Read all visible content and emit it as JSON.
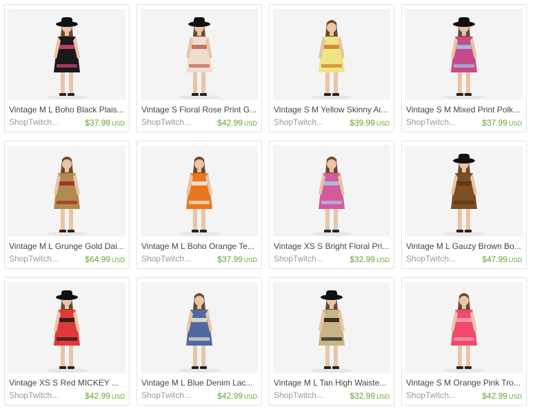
{
  "listings": [
    {
      "title": "Vintage M L Boho Black Plais...",
      "shop": "ShopTwitch...",
      "price": "$37.99",
      "currency": "USD",
      "garment_color": "#1a1a1a",
      "accent_color": "#d9477a",
      "hat": true
    },
    {
      "title": "Vintage S Floral Rose Print G...",
      "shop": "ShopTwitch...",
      "price": "$42.99",
      "currency": "USD",
      "garment_color": "#f0ddd0",
      "accent_color": "#c0614a",
      "hat": true
    },
    {
      "title": "Vintage S M Yellow Skinny Ai...",
      "shop": "ShopTwitch...",
      "price": "$39.99",
      "currency": "USD",
      "garment_color": "#efe585",
      "accent_color": "#d07a2a",
      "hat": false
    },
    {
      "title": "Vintage S M Mixed Print Polk...",
      "shop": "ShopTwitch...",
      "price": "$37.99",
      "currency": "USD",
      "garment_color": "#c64b8a",
      "accent_color": "#9cc7e6",
      "hat": true
    },
    {
      "title": "Vintage M L Grunge Gold Dai...",
      "shop": "ShopTwitch...",
      "price": "$64.99",
      "currency": "USD",
      "garment_color": "#b38a4d",
      "accent_color": "#a3262a",
      "hat": false
    },
    {
      "title": "Vintage M L Boho Orange Te...",
      "shop": "ShopTwitch...",
      "price": "$37.99",
      "currency": "USD",
      "garment_color": "#e8761e",
      "accent_color": "#f6efe4",
      "hat": false
    },
    {
      "title": "Vintage XS S Bright Floral Pri...",
      "shop": "ShopTwitch...",
      "price": "$32.99",
      "currency": "USD",
      "garment_color": "#d35a9c",
      "accent_color": "#a9c9e8",
      "hat": false
    },
    {
      "title": "Vintage M L Gauzy Brown Bo...",
      "shop": "ShopTwitch...",
      "price": "$47.99",
      "currency": "USD",
      "garment_color": "#7a4f22",
      "accent_color": "#5a3716",
      "hat": true
    },
    {
      "title": "Vintage XS S Red MICKEY ...",
      "shop": "ShopTwitch...",
      "price": "$42.99",
      "currency": "USD",
      "garment_color": "#e0393a",
      "accent_color": "#1a1a1a",
      "hat": true
    },
    {
      "title": "Vintage M L Blue Denim Lac...",
      "shop": "ShopTwitch...",
      "price": "$42.99",
      "currency": "USD",
      "garment_color": "#4f6aa0",
      "accent_color": "#efe6d6",
      "hat": false
    },
    {
      "title": "Vintage M L Tan High Waiste...",
      "shop": "ShopTwitch...",
      "price": "$32.99",
      "currency": "USD",
      "garment_color": "#c8b487",
      "accent_color": "#1a1a1a",
      "hat": true
    },
    {
      "title": "Vintage S M Orange Pink Tro...",
      "shop": "ShopTwitch...",
      "price": "$42.99",
      "currency": "USD",
      "garment_color": "#f04a68",
      "accent_color": "#f6a0b8",
      "hat": false
    }
  ]
}
